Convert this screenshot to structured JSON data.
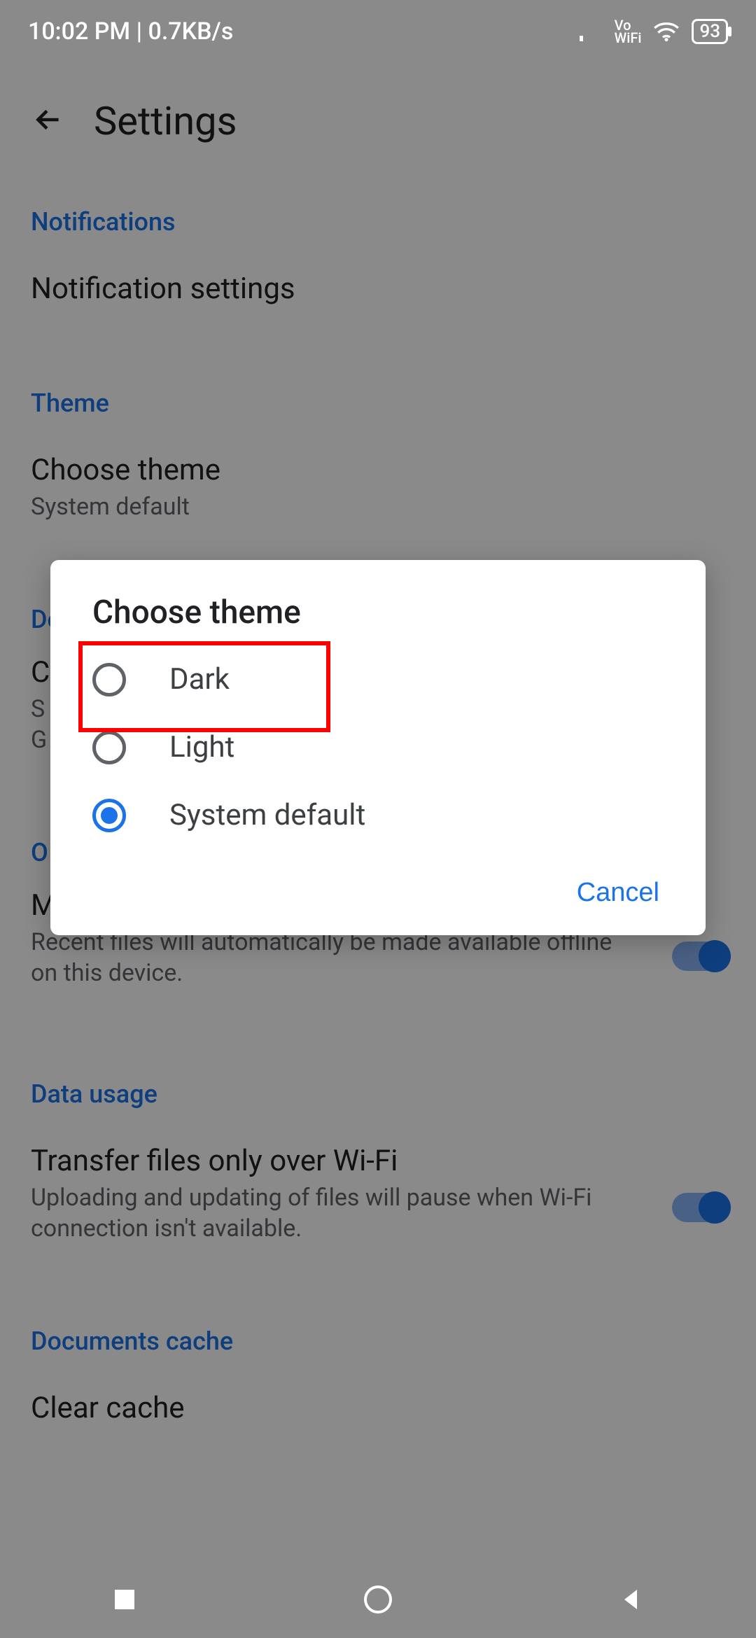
{
  "status_bar": {
    "time": "10:02 PM",
    "net_speed": "0.7KB/s",
    "vowifi_line1": "Vo",
    "vowifi_line2": "WiFi",
    "battery_pct": "93"
  },
  "app_bar": {
    "title": "Settings"
  },
  "sections": {
    "notifications": {
      "header": "Notifications",
      "item_title": "Notification settings"
    },
    "theme": {
      "header": "Theme",
      "choose_title": "Choose theme",
      "choose_sub": "System default",
      "documents_header": "Documents"
    },
    "cache_row": {
      "title_prefix": "C",
      "sub_line1": "S",
      "sub_line2": "G"
    },
    "offline_header_prefix": "O",
    "offline": {
      "title_prefix": "M",
      "sub": "Recent files will automatically be made available offline on this device."
    },
    "data_usage": {
      "header": "Data usage",
      "item_title": "Transfer files only over Wi-Fi",
      "item_sub": "Uploading and updating of files will pause when Wi-Fi connection isn't available."
    },
    "documents_cache": {
      "header": "Documents cache",
      "item_title": "Clear cache"
    }
  },
  "dialog": {
    "title": "Choose theme",
    "options": {
      "dark": "Dark",
      "light": "Light",
      "system": "System default"
    },
    "selected": "system",
    "cancel": "Cancel"
  },
  "colors": {
    "accent": "#1a73e8"
  }
}
